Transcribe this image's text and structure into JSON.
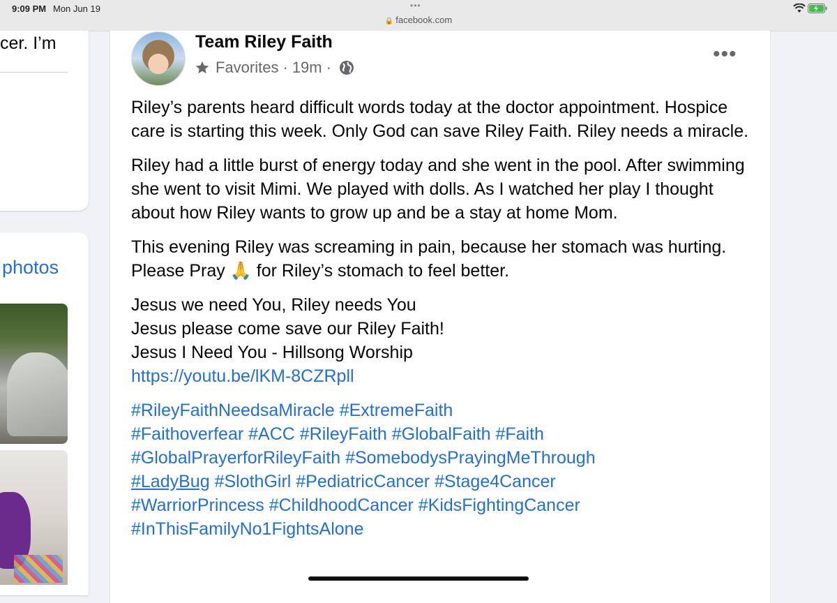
{
  "status_bar": {
    "time": "9:09 PM",
    "date": "Mon Jun 19",
    "url": "facebook.com",
    "lock_icon": "lock-icon",
    "wifi_icon": "wifi-icon",
    "battery_icon": "battery-charging-icon"
  },
  "left_column": {
    "top_text": "cer. I’m",
    "photos_label": "photos"
  },
  "post": {
    "author": "Team Riley Faith",
    "audience": "Favorites",
    "time_ago": "19m",
    "separator": "·",
    "more_label": "•••",
    "paragraphs": [
      "Riley’s parents heard difficult words today at the doctor appointment. Hospice care is starting this week. Only God can save Riley Faith. Riley needs a miracle.",
      "Riley had a little burst of energy today and she went in the pool. After swimming she went to visit Mimi. We played with dolls. As I watched her play I thought about how Riley wants to grow up and be a stay at home Mom.",
      "This evening Riley was screaming in pain, because her stomach was hurting. Please Pray 🙏 for Riley’s stomach to feel better."
    ],
    "lyrics_lines": [
      "Jesus we need You, Riley needs You",
      "Jesus please come save our Riley Faith!",
      "Jesus I Need You - Hillsong Worship"
    ],
    "link": "https://youtu.be/lKM-8CZRpll",
    "hashtag_lines": [
      "#RileyFaithNeedsaMiracle #ExtremeFaith",
      "#Faithoverfear #ACC #RileyFaith #GlobalFaith #Faith",
      "#GlobalPrayerforRileyFaith #SomebodysPrayingMeThrough",
      "#PediatricCancer #Stage4Cancer",
      "#WarriorPrincess #ChildhoodCancer  #KidsFightingCancer",
      "#InThisFamilyNo1FightsAlone"
    ],
    "hashtag_line4_prefix": [
      "#LadyBug",
      "#SlothGirl"
    ]
  },
  "colors": {
    "link_blue": "#216fdb",
    "secondary_text": "#65676b",
    "background": "#f0f2f5"
  }
}
